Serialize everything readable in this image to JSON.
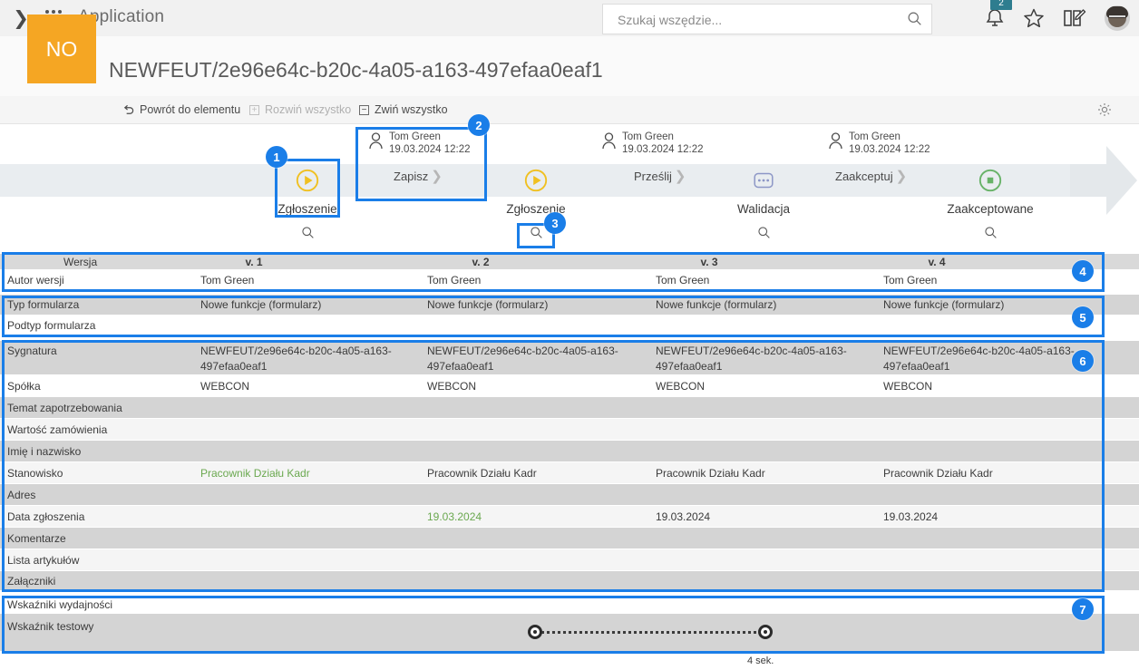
{
  "topbar": {
    "app_title": "Application",
    "chevron_icon": "chevron-right-icon",
    "waffle_icon": "app-grid-icon",
    "search_placeholder": "Szukaj wszędzie...",
    "search_value": "",
    "search_icon": "search-icon",
    "notification_icon": "notification-bell-icon",
    "notification_count": "2",
    "favorites_icon": "star-icon",
    "reports_icon": "edit-note-icon",
    "avatar_icon": "user-avatar"
  },
  "document": {
    "badge": "NO",
    "title": "NEWFEUT/2e96e64c-b20c-4a05-a163-497efaa0eaf1",
    "accent_color": "#f5a623"
  },
  "toolbar": {
    "back_label": "Powrót do elementu",
    "back_icon": "undo-arrow-icon",
    "expand_label": "Rozwiń wszystko",
    "expand_icon": "plus-box-icon",
    "collapse_label": "Zwiń wszystko",
    "collapse_icon": "minus-box-icon",
    "settings_icon": "gear-icon"
  },
  "workflow": {
    "steps": [
      {
        "person_name": "",
        "person_date": "",
        "action_label": "",
        "icon": "play-circle-icon",
        "icon_color": "#f0c020",
        "label": "Zgłoszenie",
        "magnifier_icon": "search-icon"
      },
      {
        "person_name": "Tom Green",
        "person_date": "19.03.2024 12:22",
        "action_label": "Zapisz",
        "icon": "",
        "icon_color": "",
        "label": "",
        "magnifier_icon": ""
      },
      {
        "person_name": "",
        "person_date": "",
        "action_label": "",
        "icon": "play-circle-icon",
        "icon_color": "#f0c020",
        "label": "Zgłoszenie",
        "magnifier_icon": "search-icon"
      },
      {
        "person_name": "Tom Green",
        "person_date": "19.03.2024 12:22",
        "action_label": "Prześlij",
        "icon": "",
        "icon_color": "",
        "label": "",
        "magnifier_icon": ""
      },
      {
        "person_name": "",
        "person_date": "",
        "action_label": "",
        "icon": "ellipsis-box-icon",
        "icon_color": "#8c96c6",
        "label": "Walidacja",
        "magnifier_icon": "search-icon"
      },
      {
        "person_name": "Tom Green",
        "person_date": "19.03.2024 12:22",
        "action_label": "Zaakceptuj",
        "icon": "",
        "icon_color": "",
        "label": "",
        "magnifier_icon": ""
      },
      {
        "person_name": "",
        "person_date": "",
        "action_label": "",
        "icon": "stop-circle-icon",
        "icon_color": "#67b267",
        "label": "Zaakceptowane",
        "magnifier_icon": "search-icon"
      }
    ],
    "arrow_icon": "right-arrow-shape"
  },
  "table": {
    "version_header_label": "Wersja",
    "version_columns": [
      "v. 1",
      "v. 2",
      "v. 3",
      "v. 4"
    ],
    "rows": [
      {
        "label": "Autor wersji",
        "values": [
          "Tom Green",
          "Tom Green",
          "Tom Green",
          "Tom Green"
        ]
      },
      {
        "label": "Typ formularza",
        "values": [
          "Nowe funkcje (formularz)",
          "Nowe funkcje (formularz)",
          "Nowe funkcje (formularz)",
          "Nowe funkcje (formularz)"
        ]
      },
      {
        "label": "Podtyp formularza",
        "values": [
          "",
          "",
          "",
          ""
        ]
      },
      {
        "label": "Sygnatura",
        "values": [
          "NEWFEUT/2e96e64c-b20c-4a05-a163-\n497efaa0eaf1",
          "NEWFEUT/2e96e64c-b20c-4a05-a163-\n497efaa0eaf1",
          "NEWFEUT/2e96e64c-b20c-4a05-a163-\n497efaa0eaf1",
          "NEWFEUT/2e96e64c-b20c-4a05-a163-\n497efaa0eaf1"
        ]
      },
      {
        "label": "Spółka",
        "values": [
          "WEBCON",
          "WEBCON",
          "WEBCON",
          "WEBCON"
        ]
      },
      {
        "label": "Temat zapotrzebowania",
        "values": [
          "",
          "",
          "",
          ""
        ]
      },
      {
        "label": "Wartość zamówienia",
        "values": [
          "",
          "",
          "",
          ""
        ]
      },
      {
        "label": "Imię i nazwisko",
        "values": [
          "",
          "",
          "",
          ""
        ]
      },
      {
        "label": "Stanowisko",
        "values": [
          "Pracownik Działu Kadr",
          "Pracownik Działu Kadr",
          "Pracownik Działu Kadr",
          "Pracownik Działu Kadr"
        ]
      },
      {
        "label": "Adres",
        "values": [
          "",
          "",
          "",
          ""
        ]
      },
      {
        "label": "Data zgłoszenia",
        "values": [
          "",
          "19.03.2024",
          "19.03.2024",
          "19.03.2024"
        ]
      },
      {
        "label": "Komentarze",
        "values": [
          "",
          "",
          "",
          ""
        ]
      },
      {
        "label": "Lista artykułów",
        "values": [
          "",
          "",
          "",
          ""
        ]
      },
      {
        "label": "Załączniki",
        "values": [
          "",
          "",
          "",
          ""
        ]
      },
      {
        "label": "Wskaźniki wydajności",
        "values": [
          "",
          "",
          "",
          ""
        ]
      },
      {
        "label": "Wskaźnik testowy",
        "values": [
          "",
          "",
          "",
          ""
        ]
      }
    ],
    "changed_cells": [
      "Stanowisko:0",
      "Data zgłoszenia:1"
    ],
    "slider": {
      "caption": "4 sek.",
      "left_icon": "slider-handle-icon",
      "right_icon": "slider-handle-icon"
    }
  },
  "callouts": [
    {
      "number": "1"
    },
    {
      "number": "2"
    },
    {
      "number": "3"
    },
    {
      "number": "4"
    },
    {
      "number": "5"
    },
    {
      "number": "6"
    },
    {
      "number": "7"
    }
  ]
}
